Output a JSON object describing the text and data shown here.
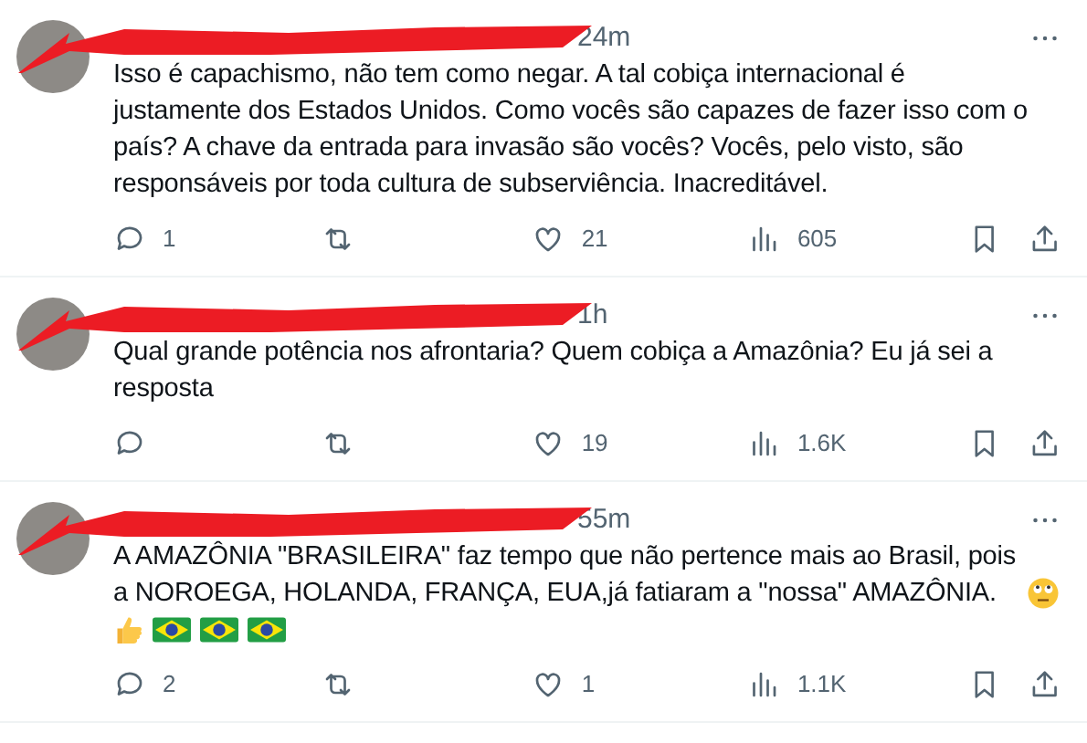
{
  "tweets": [
    {
      "time": "24m",
      "text": "Isso é capachismo, não tem como negar. A tal cobiça internacional é justamente dos Estados Unidos. Como vocês são capazes de fazer isso com o país? A chave da entrada para invasão são vocês? Vocês, pelo visto, são responsáveis por toda cultura de subserviência. Inacreditável.",
      "replies": "1",
      "likes": "21",
      "views": "605"
    },
    {
      "time": "1h",
      "text": "Qual grande potência nos afrontaria? Quem cobiça a Amazônia? Eu já sei a resposta",
      "likes": "19",
      "views": "1.6K"
    },
    {
      "time": "55m",
      "text": "A AMAZÔNIA \"BRASILEIRA\" faz tempo que não pertence mais ao Brasil, pois a NOROEGA, HOLANDA, FRANÇA, EUA,já fatiaram a \"nossa\" AMAZÔNIA.",
      "end_icons": [
        {
          "kind": "rolling_eyes"
        }
      ],
      "emoji_line": [
        {
          "kind": "thumbs_up"
        },
        {
          "kind": "flag"
        },
        {
          "kind": "flag"
        },
        {
          "kind": "flag"
        }
      ],
      "replies": "2",
      "likes": "1",
      "views": "1.1K"
    }
  ]
}
